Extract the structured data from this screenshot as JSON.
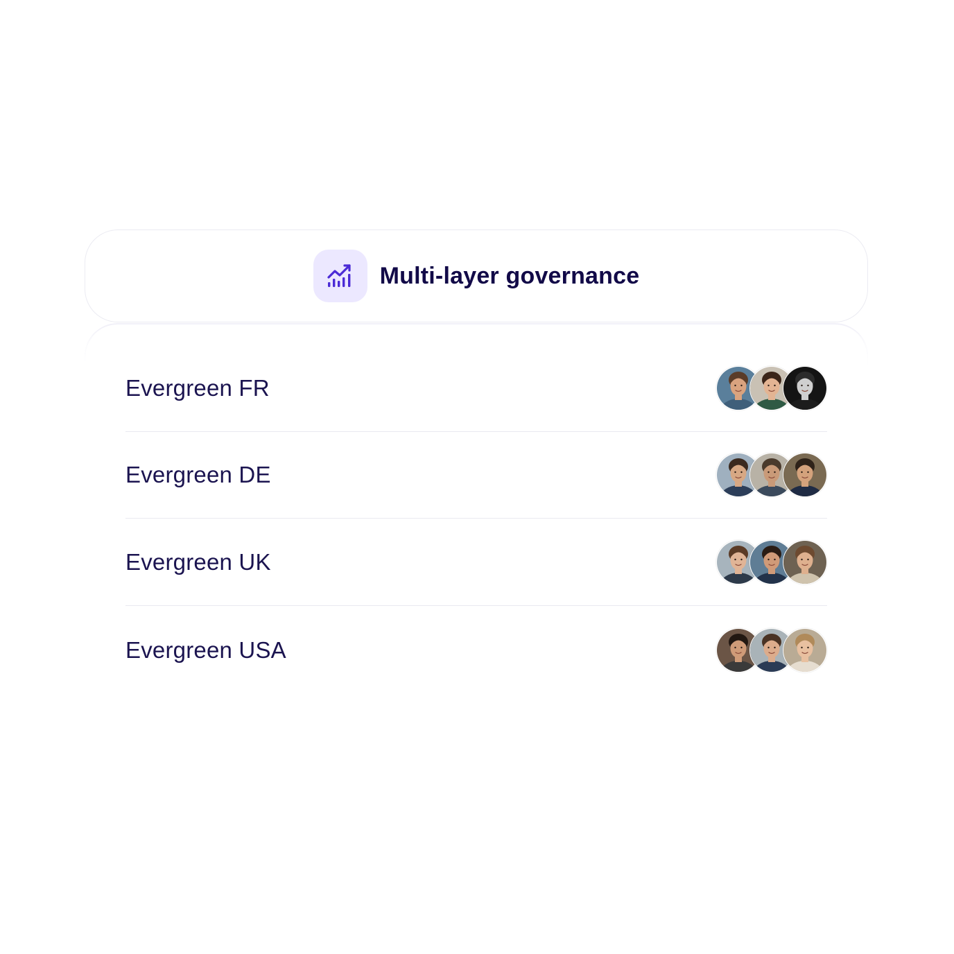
{
  "header": {
    "title": "Multi-layer governance",
    "icon": "growth-chart-icon",
    "icon_color": "#4b2bd6",
    "icon_bg": "#ece8ff"
  },
  "entities": [
    {
      "label": "Evergreen FR",
      "avatars": [
        {
          "bg": "#5a7f9b",
          "skin": "#d9a37f",
          "hair": "#5a3c28",
          "shirt": "#3f5f7a"
        },
        {
          "bg": "#c9c1b4",
          "skin": "#e3b493",
          "hair": "#3a2418",
          "shirt": "#2f5a44"
        },
        {
          "bg": "#141414",
          "skin": "#cfcfcf",
          "hair": "#2b2b2b",
          "shirt": "#1c1c1c"
        }
      ]
    },
    {
      "label": "Evergreen DE",
      "avatars": [
        {
          "bg": "#9fb0bf",
          "skin": "#d7a884",
          "hair": "#3b2a1f",
          "shirt": "#2c3e59"
        },
        {
          "bg": "#b8b2a6",
          "skin": "#c99a78",
          "hair": "#4a3a2c",
          "shirt": "#3b4a5c"
        },
        {
          "bg": "#7a6a52",
          "skin": "#d4a27c",
          "hair": "#2e2219",
          "shirt": "#1f2b44"
        }
      ]
    },
    {
      "label": "Evergreen UK",
      "avatars": [
        {
          "bg": "#a7b4bd",
          "skin": "#e0b496",
          "hair": "#5b3b26",
          "shirt": "#2d3a4a"
        },
        {
          "bg": "#5f7d95",
          "skin": "#d09a78",
          "hair": "#2a1c14",
          "shirt": "#22324a"
        },
        {
          "bg": "#6e6252",
          "skin": "#deb08e",
          "hair": "#6d4a30",
          "shirt": "#cfc3ad"
        }
      ]
    },
    {
      "label": "Evergreen USA",
      "avatars": [
        {
          "bg": "#6b5546",
          "skin": "#cf9b78",
          "hair": "#221812",
          "shirt": "#3a3a3a"
        },
        {
          "bg": "#a9b3b8",
          "skin": "#dcac8c",
          "hair": "#4a3324",
          "shirt": "#2b3b55"
        },
        {
          "bg": "#b9ab95",
          "skin": "#e8c0a0",
          "hair": "#b08a5a",
          "shirt": "#e6ddd0"
        }
      ]
    }
  ]
}
